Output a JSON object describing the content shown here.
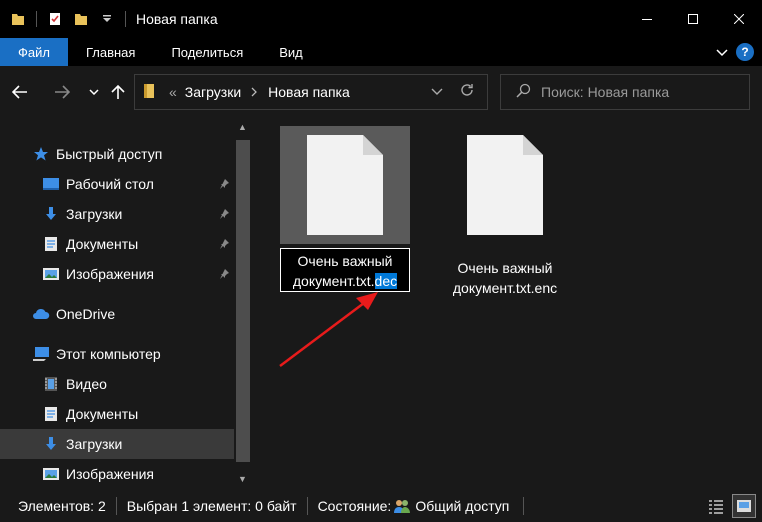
{
  "window": {
    "title": "Новая папка",
    "controls": {
      "minimize": "–",
      "maximize": "☐",
      "close": "✕"
    }
  },
  "ribbon": {
    "tabs": [
      {
        "label": "Файл",
        "active": true
      },
      {
        "label": "Главная"
      },
      {
        "label": "Поделиться"
      },
      {
        "label": "Вид"
      }
    ],
    "help_label": "?"
  },
  "navigation": {
    "breadcrumb_prefix": "«",
    "breadcrumb": [
      "Загрузки",
      "Новая папка"
    ],
    "search_placeholder": "Поиск: Новая папка"
  },
  "sidebar": {
    "items": [
      {
        "label": "Быстрый доступ",
        "icon": "star-icon"
      },
      {
        "label": "Рабочий стол",
        "icon": "desktop-icon",
        "pinned": true
      },
      {
        "label": "Загрузки",
        "icon": "download-icon",
        "pinned": true
      },
      {
        "label": "Документы",
        "icon": "documents-icon",
        "pinned": true
      },
      {
        "label": "Изображения",
        "icon": "pictures-icon",
        "pinned": true
      },
      {
        "label": "OneDrive",
        "icon": "cloud-icon"
      },
      {
        "label": "Этот компьютер",
        "icon": "computer-icon"
      },
      {
        "label": "Видео",
        "icon": "video-icon"
      },
      {
        "label": "Документы",
        "icon": "documents-icon"
      },
      {
        "label": "Загрузки",
        "icon": "download-icon",
        "selected": true
      },
      {
        "label": "Изображения",
        "icon": "pictures-icon"
      }
    ]
  },
  "files": [
    {
      "name_line1": "Очень важный",
      "name_line2_prefix": "документ.txt.",
      "name_line2_selected": "dec",
      "renaming": true,
      "selected": true
    },
    {
      "name_line1": "Очень важный",
      "name_line2": "документ.txt.enc",
      "renaming": false,
      "selected": false
    }
  ],
  "status_bar": {
    "count": "Элементов: 2",
    "selection": "Выбран 1 элемент: 0 байт",
    "state": "Состояние:",
    "sharing": "Общий доступ"
  },
  "colors": {
    "accent": "#1a6fc4",
    "selection_highlight": "#0078d7",
    "arrow": "#e81b1b",
    "background": "#191919"
  }
}
